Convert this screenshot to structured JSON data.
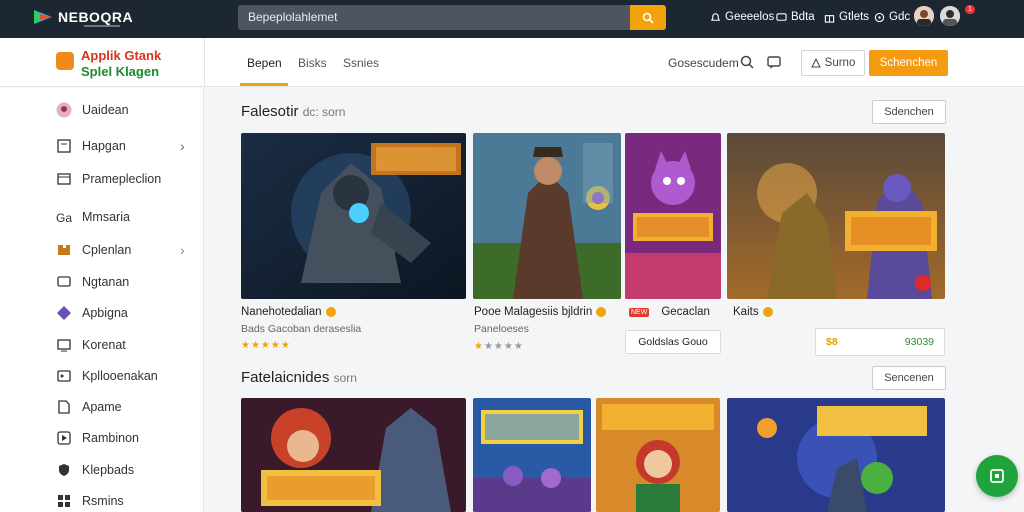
{
  "topbar": {
    "logo": "NEBOQRA",
    "search_value": "Bepeplolahlemet",
    "links": [
      "Geeeelos",
      "Bdta",
      "Gtlets",
      "Gdc"
    ],
    "notif_count": "1"
  },
  "subheader": {
    "brand_line1": "Applik Gtank",
    "brand_line2": "Splel Klagen",
    "tabs": [
      "Bepen",
      "Bisks",
      "Ssnies"
    ],
    "right_link": "Gosescudem",
    "outline_button": "Surno",
    "primary_button": "Schenchen"
  },
  "sidebar": {
    "items": [
      {
        "label": "Uaidean",
        "icon": "game-avatar-icon"
      },
      {
        "label": "Hapgan",
        "icon": "book-icon"
      },
      {
        "label": "Pramepleclion",
        "icon": "window-icon"
      },
      {
        "label": "Mmsaria",
        "icon": "gamepad-icon"
      },
      {
        "label": "Cplenlan",
        "icon": "puzzle-icon"
      },
      {
        "label": "Ngtanan",
        "icon": "tv-icon"
      },
      {
        "label": "Apbigna",
        "icon": "gem-icon"
      },
      {
        "label": "Korenat",
        "icon": "monitor-icon"
      },
      {
        "label": "Kpllooenakan",
        "icon": "card-icon"
      },
      {
        "label": "Apame",
        "icon": "doc-icon"
      },
      {
        "label": "Rambinon",
        "icon": "media-icon"
      },
      {
        "label": "Klepbads",
        "icon": "shield-icon"
      },
      {
        "label": "Rsmins",
        "icon": "grid-icon"
      }
    ]
  },
  "section1": {
    "title": "Falesotir",
    "title_small": "dc: sorn",
    "more": "Sdenchen",
    "games": [
      {
        "title": "Nanehotedalian",
        "sub": "Bads Gacoban deraseslia",
        "rating": 5
      },
      {
        "title": "Pooe Malagesiis bjldrin",
        "sub": "Paneloeses",
        "rating": 1
      },
      {
        "tag": "NEW",
        "title": "Gecaclan",
        "box_text": "Goldslas Gouo"
      },
      {
        "title": "Kaits",
        "price": "$8"
      }
    ],
    "price_right": "93039"
  },
  "section2": {
    "title": "Fatelaicnides",
    "title_small": "sorn",
    "more": "Sencenen"
  }
}
